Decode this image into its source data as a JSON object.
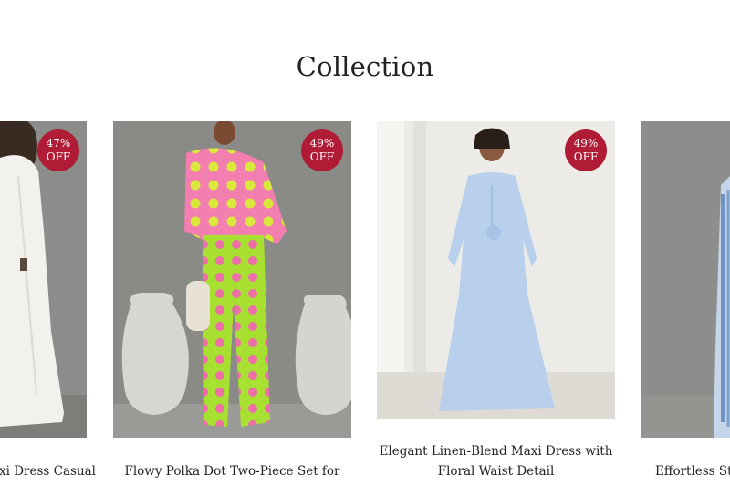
{
  "section": {
    "title": "Collection"
  },
  "products": [
    {
      "name": "Maxi Dress Casual",
      "display_name": "xi Dress Casual",
      "badge_pct": "47%",
      "badge_off": "OFF"
    },
    {
      "name": "Flowy Polka Dot Two-Piece Set for",
      "badge_pct": "49%",
      "badge_off": "OFF"
    },
    {
      "name_line1": "Elegant Linen-Blend Maxi Dress with",
      "name_line2": "Floral Waist Detail",
      "badge_pct": "49%",
      "badge_off": "OFF"
    },
    {
      "name": "Effortless Str"
    }
  ],
  "colors": {
    "badge": "#b01c35",
    "text": "#222222"
  }
}
